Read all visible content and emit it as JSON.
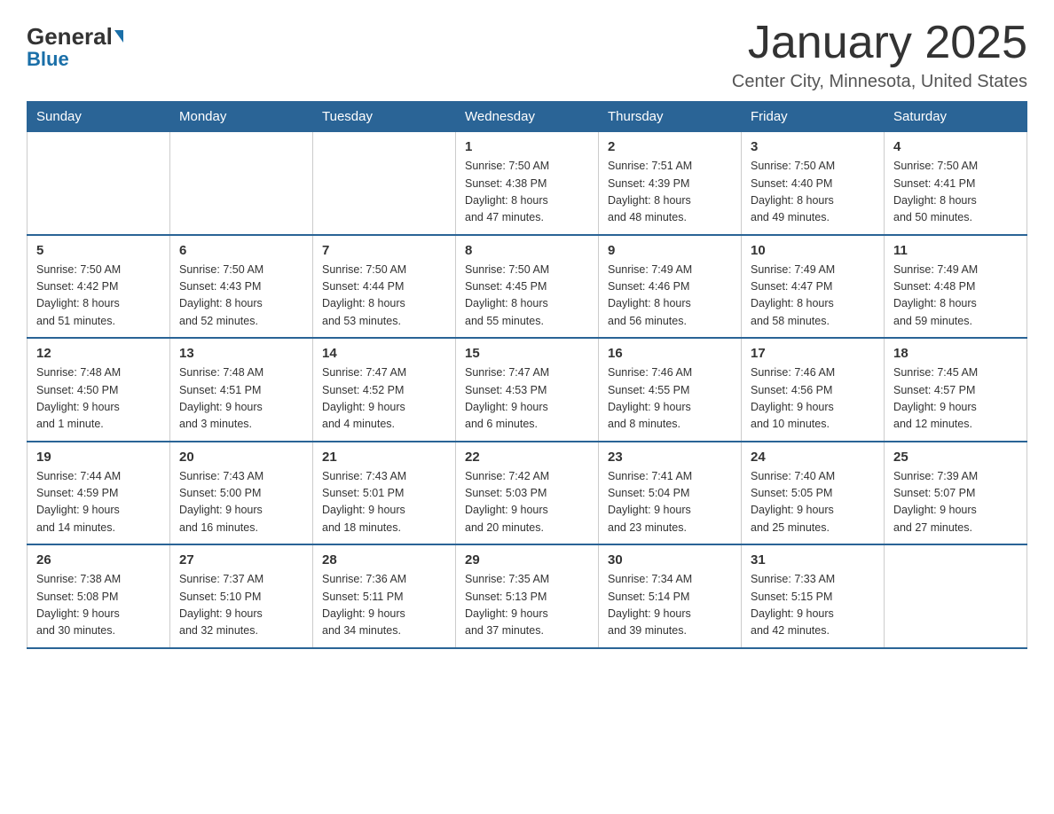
{
  "header": {
    "logo_general": "General",
    "logo_blue": "Blue",
    "month_title": "January 2025",
    "location": "Center City, Minnesota, United States"
  },
  "days_of_week": [
    "Sunday",
    "Monday",
    "Tuesday",
    "Wednesday",
    "Thursday",
    "Friday",
    "Saturday"
  ],
  "weeks": [
    [
      {
        "day": "",
        "info": ""
      },
      {
        "day": "",
        "info": ""
      },
      {
        "day": "",
        "info": ""
      },
      {
        "day": "1",
        "info": "Sunrise: 7:50 AM\nSunset: 4:38 PM\nDaylight: 8 hours\nand 47 minutes."
      },
      {
        "day": "2",
        "info": "Sunrise: 7:51 AM\nSunset: 4:39 PM\nDaylight: 8 hours\nand 48 minutes."
      },
      {
        "day": "3",
        "info": "Sunrise: 7:50 AM\nSunset: 4:40 PM\nDaylight: 8 hours\nand 49 minutes."
      },
      {
        "day": "4",
        "info": "Sunrise: 7:50 AM\nSunset: 4:41 PM\nDaylight: 8 hours\nand 50 minutes."
      }
    ],
    [
      {
        "day": "5",
        "info": "Sunrise: 7:50 AM\nSunset: 4:42 PM\nDaylight: 8 hours\nand 51 minutes."
      },
      {
        "day": "6",
        "info": "Sunrise: 7:50 AM\nSunset: 4:43 PM\nDaylight: 8 hours\nand 52 minutes."
      },
      {
        "day": "7",
        "info": "Sunrise: 7:50 AM\nSunset: 4:44 PM\nDaylight: 8 hours\nand 53 minutes."
      },
      {
        "day": "8",
        "info": "Sunrise: 7:50 AM\nSunset: 4:45 PM\nDaylight: 8 hours\nand 55 minutes."
      },
      {
        "day": "9",
        "info": "Sunrise: 7:49 AM\nSunset: 4:46 PM\nDaylight: 8 hours\nand 56 minutes."
      },
      {
        "day": "10",
        "info": "Sunrise: 7:49 AM\nSunset: 4:47 PM\nDaylight: 8 hours\nand 58 minutes."
      },
      {
        "day": "11",
        "info": "Sunrise: 7:49 AM\nSunset: 4:48 PM\nDaylight: 8 hours\nand 59 minutes."
      }
    ],
    [
      {
        "day": "12",
        "info": "Sunrise: 7:48 AM\nSunset: 4:50 PM\nDaylight: 9 hours\nand 1 minute."
      },
      {
        "day": "13",
        "info": "Sunrise: 7:48 AM\nSunset: 4:51 PM\nDaylight: 9 hours\nand 3 minutes."
      },
      {
        "day": "14",
        "info": "Sunrise: 7:47 AM\nSunset: 4:52 PM\nDaylight: 9 hours\nand 4 minutes."
      },
      {
        "day": "15",
        "info": "Sunrise: 7:47 AM\nSunset: 4:53 PM\nDaylight: 9 hours\nand 6 minutes."
      },
      {
        "day": "16",
        "info": "Sunrise: 7:46 AM\nSunset: 4:55 PM\nDaylight: 9 hours\nand 8 minutes."
      },
      {
        "day": "17",
        "info": "Sunrise: 7:46 AM\nSunset: 4:56 PM\nDaylight: 9 hours\nand 10 minutes."
      },
      {
        "day": "18",
        "info": "Sunrise: 7:45 AM\nSunset: 4:57 PM\nDaylight: 9 hours\nand 12 minutes."
      }
    ],
    [
      {
        "day": "19",
        "info": "Sunrise: 7:44 AM\nSunset: 4:59 PM\nDaylight: 9 hours\nand 14 minutes."
      },
      {
        "day": "20",
        "info": "Sunrise: 7:43 AM\nSunset: 5:00 PM\nDaylight: 9 hours\nand 16 minutes."
      },
      {
        "day": "21",
        "info": "Sunrise: 7:43 AM\nSunset: 5:01 PM\nDaylight: 9 hours\nand 18 minutes."
      },
      {
        "day": "22",
        "info": "Sunrise: 7:42 AM\nSunset: 5:03 PM\nDaylight: 9 hours\nand 20 minutes."
      },
      {
        "day": "23",
        "info": "Sunrise: 7:41 AM\nSunset: 5:04 PM\nDaylight: 9 hours\nand 23 minutes."
      },
      {
        "day": "24",
        "info": "Sunrise: 7:40 AM\nSunset: 5:05 PM\nDaylight: 9 hours\nand 25 minutes."
      },
      {
        "day": "25",
        "info": "Sunrise: 7:39 AM\nSunset: 5:07 PM\nDaylight: 9 hours\nand 27 minutes."
      }
    ],
    [
      {
        "day": "26",
        "info": "Sunrise: 7:38 AM\nSunset: 5:08 PM\nDaylight: 9 hours\nand 30 minutes."
      },
      {
        "day": "27",
        "info": "Sunrise: 7:37 AM\nSunset: 5:10 PM\nDaylight: 9 hours\nand 32 minutes."
      },
      {
        "day": "28",
        "info": "Sunrise: 7:36 AM\nSunset: 5:11 PM\nDaylight: 9 hours\nand 34 minutes."
      },
      {
        "day": "29",
        "info": "Sunrise: 7:35 AM\nSunset: 5:13 PM\nDaylight: 9 hours\nand 37 minutes."
      },
      {
        "day": "30",
        "info": "Sunrise: 7:34 AM\nSunset: 5:14 PM\nDaylight: 9 hours\nand 39 minutes."
      },
      {
        "day": "31",
        "info": "Sunrise: 7:33 AM\nSunset: 5:15 PM\nDaylight: 9 hours\nand 42 minutes."
      },
      {
        "day": "",
        "info": ""
      }
    ]
  ]
}
